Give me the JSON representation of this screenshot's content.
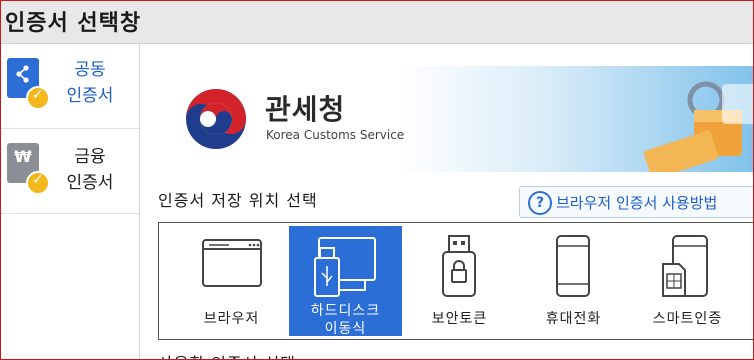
{
  "window": {
    "title": "인증서 선택창"
  },
  "sidebar": {
    "items": [
      {
        "line1": "공동",
        "line2": "인증서",
        "icon": "share-icon",
        "color": "#2a6ed6",
        "active": true
      },
      {
        "line1": "금융",
        "line2": "인증서",
        "icon": "won-icon",
        "color": "#8a8f96",
        "active": false
      }
    ]
  },
  "banner": {
    "org_name": "관세청",
    "org_name_en": "Korea Customs Service"
  },
  "storage": {
    "section_title": "인증서 저장 위치 선택",
    "help_button": "브라우저 인증서 사용방법",
    "options": [
      {
        "label": "브라우저",
        "icon": "browser-window-icon",
        "selected": false
      },
      {
        "label": "하드디스크",
        "label2": "이동식",
        "icon": "hard-disk-usb-icon",
        "selected": true
      },
      {
        "label": "보안토큰",
        "icon": "security-token-icon",
        "selected": false
      },
      {
        "label": "휴대전화",
        "icon": "mobile-phone-icon",
        "selected": false
      },
      {
        "label": "스마트인증",
        "icon": "smart-card-phone-icon",
        "selected": false
      }
    ]
  },
  "next_section_partial": "사용할 인증서 선택",
  "colors": {
    "accent": "#2a6ed6",
    "frame_border": "#c8181e",
    "titlebar_bg": "#e8e8e8"
  }
}
